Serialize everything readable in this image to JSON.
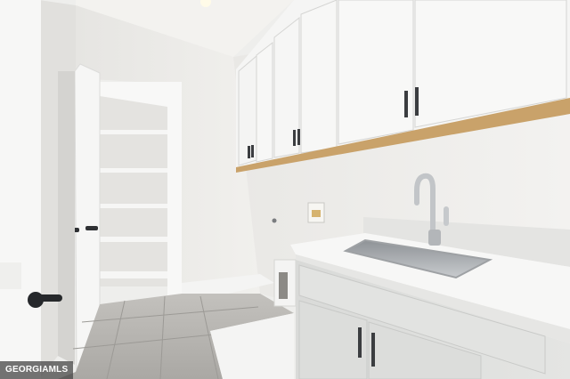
{
  "image": {
    "watermark_text": "GEORGIAMLS",
    "scene": "laundry-room",
    "palette": {
      "wall": "#ecebe8",
      "ceiling": "#f3f2ef",
      "cabinet": "#f5f5f4",
      "lower_cabinet": "#dcdddb",
      "countertop": "#f7f7f6",
      "floor_tile": "#b7b5b1",
      "wood_trim": "#c9a26a",
      "hardware": "#3b3d40",
      "steel": "#b9bcbf"
    }
  }
}
